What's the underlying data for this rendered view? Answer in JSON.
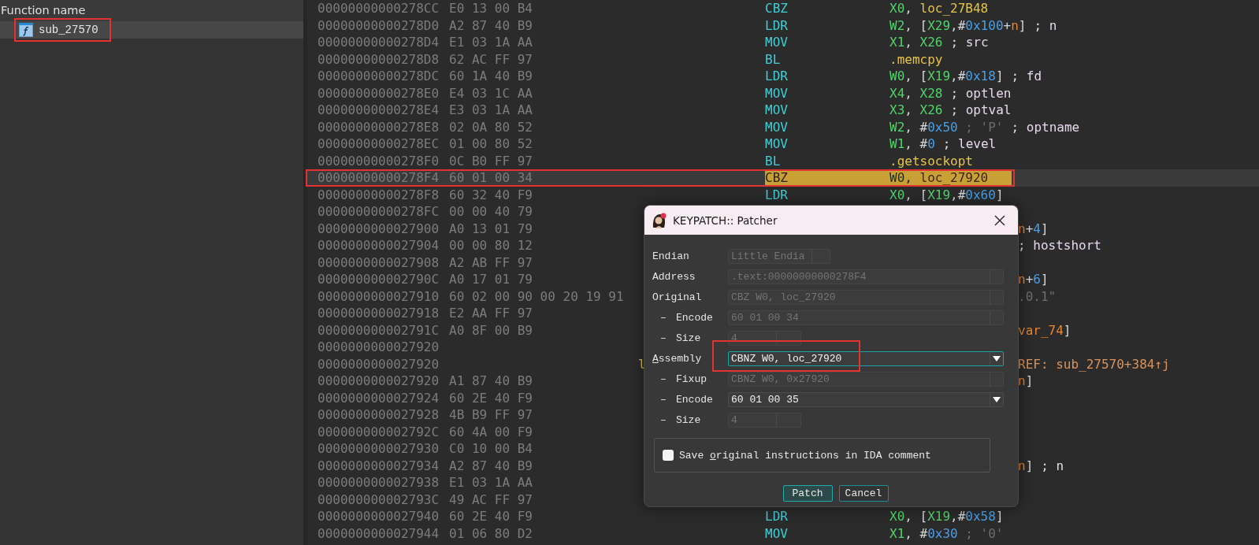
{
  "function_list": {
    "header": "Function name",
    "items": [
      {
        "name": "sub_27570",
        "selected": true,
        "annotated": true
      }
    ]
  },
  "listing": {
    "rows": [
      {
        "kind": "full",
        "address": "00000000000278CC",
        "bytes": "E0 13 00 B4",
        "mnemonic": "CBZ",
        "operands": [
          {
            "kind": "reg",
            "s": "X0"
          },
          {
            "kind": "plain",
            "s": ", "
          },
          {
            "kind": "label",
            "s": "loc_27B48"
          }
        ],
        "selected": false,
        "annotated": false
      },
      {
        "kind": "full",
        "address": "00000000000278D0",
        "bytes": "A2 87 40 B9",
        "mnemonic": "LDR",
        "operands": [
          {
            "kind": "reg",
            "s": "W2"
          },
          {
            "kind": "plain",
            "s": ", ["
          },
          {
            "kind": "reg",
            "s": "X29"
          },
          {
            "kind": "plain",
            "s": ",#"
          },
          {
            "kind": "num",
            "s": "0x100"
          },
          {
            "kind": "plain",
            "s": "+"
          },
          {
            "kind": "var",
            "s": "n"
          },
          {
            "kind": "plain",
            "s": "]"
          }
        ],
        "comment": "; n",
        "selected": false,
        "annotated": false
      },
      {
        "kind": "full",
        "address": "00000000000278D4",
        "bytes": "E1 03 1A AA",
        "mnemonic": "MOV",
        "operands": [
          {
            "kind": "reg",
            "s": "X1"
          },
          {
            "kind": "plain",
            "s": ", "
          },
          {
            "kind": "reg",
            "s": "X26"
          }
        ],
        "comment": "; src",
        "selected": false,
        "annotated": false
      },
      {
        "kind": "full",
        "address": "00000000000278D8",
        "bytes": "62 AC FF 97",
        "mnemonic": "BL",
        "operands": [
          {
            "kind": "label",
            "s": ".memcpy"
          }
        ],
        "selected": false,
        "annotated": false
      },
      {
        "kind": "full",
        "address": "00000000000278DC",
        "bytes": "60 1A 40 B9",
        "mnemonic": "LDR",
        "operands": [
          {
            "kind": "reg",
            "s": "W0"
          },
          {
            "kind": "plain",
            "s": ", ["
          },
          {
            "kind": "reg",
            "s": "X19"
          },
          {
            "kind": "plain",
            "s": ",#"
          },
          {
            "kind": "num",
            "s": "0x18"
          },
          {
            "kind": "plain",
            "s": "]"
          }
        ],
        "comment": "; fd",
        "selected": false,
        "annotated": false
      },
      {
        "kind": "full",
        "address": "00000000000278E0",
        "bytes": "E4 03 1C AA",
        "mnemonic": "MOV",
        "operands": [
          {
            "kind": "reg",
            "s": "X4"
          },
          {
            "kind": "plain",
            "s": ", "
          },
          {
            "kind": "reg",
            "s": "X28"
          }
        ],
        "comment": "; optlen",
        "selected": false,
        "annotated": false
      },
      {
        "kind": "full",
        "address": "00000000000278E4",
        "bytes": "E3 03 1A AA",
        "mnemonic": "MOV",
        "operands": [
          {
            "kind": "reg",
            "s": "X3"
          },
          {
            "kind": "plain",
            "s": ", "
          },
          {
            "kind": "reg",
            "s": "X26"
          }
        ],
        "comment": "; optval",
        "selected": false,
        "annotated": false
      },
      {
        "kind": "full",
        "address": "00000000000278E8",
        "bytes": "02 0A 80 52",
        "mnemonic": "MOV",
        "operands": [
          {
            "kind": "reg",
            "s": "W2"
          },
          {
            "kind": "plain",
            "s": ", #"
          },
          {
            "kind": "num",
            "s": "0x50"
          },
          {
            "kind": "note",
            "s": " ; 'P'"
          }
        ],
        "comment": "; optname",
        "selected": false,
        "annotated": false
      },
      {
        "kind": "full",
        "address": "00000000000278EC",
        "bytes": "01 00 80 52",
        "mnemonic": "MOV",
        "operands": [
          {
            "kind": "reg",
            "s": "W1"
          },
          {
            "kind": "plain",
            "s": ", #"
          },
          {
            "kind": "num",
            "s": "0"
          }
        ],
        "comment": "; level",
        "selected": false,
        "annotated": false
      },
      {
        "kind": "full",
        "address": "00000000000278F0",
        "bytes": "0C B0 FF 97",
        "mnemonic": "BL",
        "operands": [
          {
            "kind": "label",
            "s": ".getsockopt"
          }
        ],
        "selected": false,
        "annotated": false
      },
      {
        "kind": "full",
        "address": "00000000000278F4",
        "bytes": "60 01 00 34",
        "mnemonic": "CBZ",
        "operands": [
          {
            "kind": "reg",
            "s": "W0"
          },
          {
            "kind": "plain",
            "s": ", "
          },
          {
            "kind": "label",
            "s": "loc_27920"
          }
        ],
        "selected": true,
        "annotated": true
      },
      {
        "kind": "full",
        "address": "00000000000278F8",
        "bytes": "60 32 40 F9",
        "mnemonic": "LDR",
        "operands": [
          {
            "kind": "reg",
            "s": "X0"
          },
          {
            "kind": "plain",
            "s": ", ["
          },
          {
            "kind": "reg",
            "s": "X19"
          },
          {
            "kind": "plain",
            "s": ",#"
          },
          {
            "kind": "num",
            "s": "0x60"
          },
          {
            "kind": "plain",
            "s": "]"
          }
        ],
        "selected": false,
        "annotated": false
      },
      {
        "kind": "covered",
        "address": "00000000000278FC",
        "bytes": "00 00 40 79",
        "operands": [],
        "selected": false,
        "annotated": false
      },
      {
        "kind": "covered",
        "address": "0000000000027900",
        "bytes": "A0 13 01 79",
        "operands": [
          {
            "kind": "var",
            "s": "n"
          },
          {
            "kind": "plain",
            "s": "+"
          },
          {
            "kind": "num",
            "s": "4"
          },
          {
            "kind": "plain",
            "s": "]"
          }
        ],
        "selected": false,
        "annotated": false
      },
      {
        "kind": "covered",
        "address": "0000000000027904",
        "bytes": "00 00 80 12",
        "operands": [],
        "comment": "; hostshort",
        "selected": false,
        "annotated": false
      },
      {
        "kind": "covered",
        "address": "0000000000027908",
        "bytes": "A2 AB FF 97",
        "operands": [],
        "selected": false,
        "annotated": false
      },
      {
        "kind": "covered",
        "address": "000000000002790C",
        "bytes": "A0 17 01 79",
        "operands": [
          {
            "kind": "var",
            "s": "n"
          },
          {
            "kind": "plain",
            "s": "+"
          },
          {
            "kind": "num",
            "s": "6"
          },
          {
            "kind": "plain",
            "s": "]"
          }
        ],
        "selected": false,
        "annotated": false
      },
      {
        "kind": "covered",
        "address": "0000000000027910",
        "bytes": "60 02 00 90 00 20 19 91",
        "operands": [
          {
            "kind": "note",
            "s": ".0.1\""
          }
        ],
        "selected": false,
        "annotated": false
      },
      {
        "kind": "covered",
        "address": "0000000000027918",
        "bytes": "E2 AA FF 97",
        "operands": [],
        "selected": false,
        "annotated": false
      },
      {
        "kind": "covered",
        "address": "000000000002791C",
        "bytes": "A0 8F 00 B9",
        "operands": [
          {
            "kind": "var",
            "s": "var_74"
          },
          {
            "kind": "plain",
            "s": "]"
          }
        ],
        "selected": false,
        "annotated": false
      },
      {
        "kind": "covered",
        "address": "0000000000027920",
        "operands": [],
        "selected": false,
        "annotated": false
      },
      {
        "kind": "covered",
        "address": "0000000000027920",
        "label_fragment": "l",
        "operands": [
          {
            "kind": "xref",
            "s": "REF: sub_27570+384↑j"
          }
        ],
        "selected": false,
        "annotated": false
      },
      {
        "kind": "covered",
        "address": "0000000000027920",
        "bytes": "A1 87 40 B9",
        "operands": [
          {
            "kind": "var",
            "s": "n"
          },
          {
            "kind": "plain",
            "s": "]"
          }
        ],
        "selected": false,
        "annotated": false
      },
      {
        "kind": "covered",
        "address": "0000000000027924",
        "bytes": "60 2E 40 F9",
        "operands": [],
        "selected": false,
        "annotated": false
      },
      {
        "kind": "covered",
        "address": "0000000000027928",
        "bytes": "4B B9 FF 97",
        "operands": [],
        "selected": false,
        "annotated": false
      },
      {
        "kind": "covered",
        "address": "000000000002792C",
        "bytes": "60 4A 00 F9",
        "operands": [],
        "selected": false,
        "annotated": false
      },
      {
        "kind": "covered",
        "address": "0000000000027930",
        "bytes": "C0 10 00 B4",
        "operands": [],
        "selected": false,
        "annotated": false
      },
      {
        "kind": "covered",
        "address": "0000000000027934",
        "bytes": "A2 87 40 B9",
        "operands": [
          {
            "kind": "var",
            "s": "n"
          },
          {
            "kind": "plain",
            "s": "]"
          }
        ],
        "comment": "; n",
        "selected": false,
        "annotated": false
      },
      {
        "kind": "covered",
        "address": "0000000000027938",
        "bytes": "E1 03 1A AA",
        "operands": [],
        "selected": false,
        "annotated": false
      },
      {
        "kind": "covered",
        "address": "000000000002793C",
        "bytes": "49 AC FF 97",
        "operands": [],
        "selected": false,
        "annotated": false
      },
      {
        "kind": "full",
        "address": "0000000000027940",
        "bytes": "60 2E 40 F9",
        "mnemonic": "LDR",
        "operands": [
          {
            "kind": "reg",
            "s": "X0"
          },
          {
            "kind": "plain",
            "s": ", ["
          },
          {
            "kind": "reg",
            "s": "X19"
          },
          {
            "kind": "plain",
            "s": ",#"
          },
          {
            "kind": "num",
            "s": "0x58"
          },
          {
            "kind": "plain",
            "s": "]"
          }
        ],
        "selected": false,
        "annotated": false
      },
      {
        "kind": "full",
        "address": "0000000000027944",
        "bytes": "01 06 80 D2",
        "mnemonic": "MOV",
        "operands": [
          {
            "kind": "reg",
            "s": "X1"
          },
          {
            "kind": "plain",
            "s": ", #"
          },
          {
            "kind": "num",
            "s": "0x30"
          },
          {
            "kind": "note",
            "s": " ; '0'"
          }
        ],
        "selected": false,
        "annotated": false
      }
    ]
  },
  "dialog": {
    "title": "KEYPATCH:: Patcher",
    "fields": [
      {
        "label": "Endian",
        "kind": "select",
        "value": "Little Endia",
        "disabled": true,
        "focused": false,
        "annotated": false
      },
      {
        "label": "Address",
        "kind": "box",
        "value": ".text:00000000000278F4",
        "disabled": true,
        "focused": false,
        "annotated": false
      },
      {
        "label": "Original",
        "kind": "box",
        "value": "CBZ W0, loc_27920",
        "disabled": true,
        "focused": false,
        "annotated": false
      },
      {
        "bullet": "–",
        "label": "Encode",
        "kind": "box",
        "value": "60 01 00 34",
        "disabled": true,
        "focused": false,
        "annotated": false
      },
      {
        "bullet": "–",
        "label": "Size",
        "kind": "spin",
        "value": "4",
        "disabled": true,
        "focused": false,
        "annotated": false
      },
      {
        "label_key": "A",
        "label_rest": "ssembly",
        "kind": "dropdown",
        "value": "CBNZ W0, loc_27920",
        "disabled": false,
        "focused": true,
        "annotated": true
      },
      {
        "bullet": "–",
        "label": "Fixup",
        "kind": "box",
        "value": "CBNZ W0, 0x27920",
        "disabled": true,
        "focused": false,
        "annotated": false
      },
      {
        "bullet": "–",
        "label": "Encode",
        "kind": "dropdown",
        "value": "60 01 00 35",
        "disabled": false,
        "focused": false,
        "annotated": false
      },
      {
        "bullet": "–",
        "label": "Size",
        "kind": "spin",
        "value": "4",
        "disabled": true,
        "focused": false,
        "annotated": false
      }
    ],
    "checkbox": {
      "label_before": "Save ",
      "label_key": "o",
      "label_rest": "riginal instructions in IDA comment",
      "checked": false
    },
    "buttons": [
      {
        "label": "Patch",
        "default": true
      },
      {
        "label": "Cancel",
        "default": false
      }
    ]
  }
}
